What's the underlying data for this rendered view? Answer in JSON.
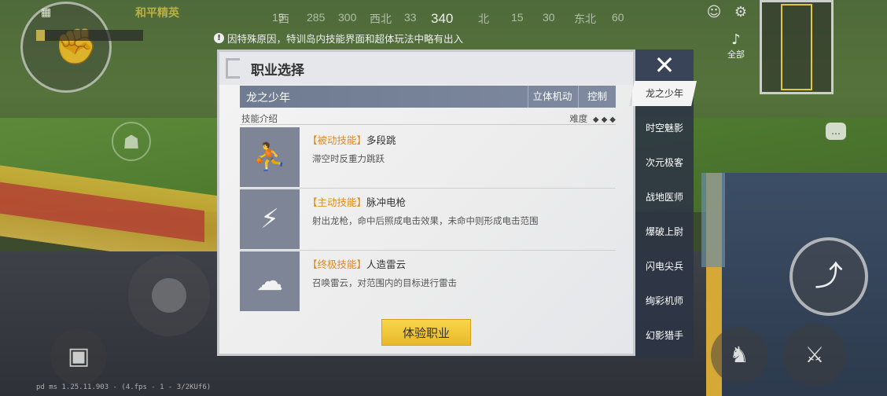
{
  "hud": {
    "brand": "和平精英",
    "compass": [
      {
        "label": "15",
        "main": false
      },
      {
        "label": "西",
        "main": false
      },
      {
        "label": "285",
        "main": false
      },
      {
        "label": "300",
        "main": false
      },
      {
        "label": "西北",
        "main": false
      },
      {
        "label": "33",
        "main": false
      },
      {
        "label": "340",
        "main": true
      },
      {
        "label": "北",
        "main": false
      },
      {
        "label": "15",
        "main": false
      },
      {
        "label": "30",
        "main": false
      },
      {
        "label": "东北",
        "main": false
      },
      {
        "label": "60",
        "main": false
      }
    ],
    "notice": "因特殊原因，特训岛内技能界面和超体玩法中略有出入",
    "all_label": "全部",
    "debug_text": "pd ms 1.25.11.903 - (4.fps - 1 - 3/2KUf6)"
  },
  "panel": {
    "title": "职业选择",
    "selected_class": "龙之少年",
    "tags": [
      "立体机动",
      "控制"
    ],
    "intro_label": "技能介绍",
    "difficulty_label": "难度",
    "difficulty_level": 3,
    "skills": [
      {
        "type": "【被动技能】",
        "name": "多段跳",
        "desc": "滞空时反重力跳跃",
        "icon": "double-jump-icon"
      },
      {
        "type": "【主动技能】",
        "name": "脉冲电枪",
        "desc": "射出龙枪，命中后照成电击效果，未命中则形成电击范围",
        "icon": "pulse-spear-icon"
      },
      {
        "type": "【终极技能】",
        "name": "人造雷云",
        "desc": "召唤雷云，对范围内的目标进行雷击",
        "icon": "thundercloud-icon"
      }
    ],
    "try_button": "体验职业",
    "accent_color": "#e08a1e",
    "button_color": "#f2c93c"
  },
  "class_list": [
    {
      "label": "龙之少年",
      "active": true
    },
    {
      "label": "时空魅影",
      "active": false
    },
    {
      "label": "次元极客",
      "active": false
    },
    {
      "label": "战地医师",
      "active": false
    },
    {
      "label": "爆破上尉",
      "active": false
    },
    {
      "label": "闪电尖兵",
      "active": false
    },
    {
      "label": "绚彩机师",
      "active": false
    },
    {
      "label": "幻影猎手",
      "active": false
    }
  ]
}
